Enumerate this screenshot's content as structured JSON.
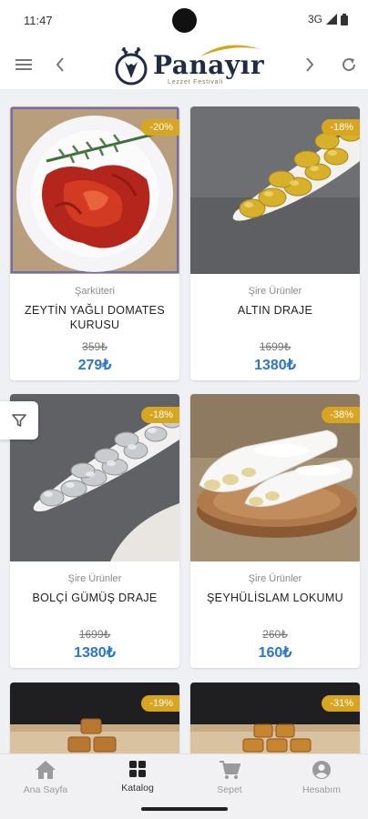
{
  "status_bar": {
    "time": "11:47",
    "network": "3G"
  },
  "header": {
    "brand": "Panayır",
    "tagline": "Lezzet Festivali"
  },
  "products": [
    {
      "category": "Şarküteri",
      "name": "ZEYTİN YAĞLI DOMATES KURUSU",
      "old_price": "359₺",
      "price": "279₺",
      "discount": "-20%",
      "image": "sun-dried-tomatoes"
    },
    {
      "category": "Şire Ürünler",
      "name": "ALTIN DRAJE",
      "old_price": "1699₺",
      "price": "1380₺",
      "discount": "-18%",
      "image": "gold-dragee"
    },
    {
      "category": "Şire Ürünler",
      "name": "BOLÇİ GÜMÜŞ DRAJE",
      "old_price": "1699₺",
      "price": "1380₺",
      "discount": "-18%",
      "image": "silver-dragee"
    },
    {
      "category": "Şire Ürünler",
      "name": "ŞEYHÜLİSLAM LOKUMU",
      "old_price": "260₺",
      "price": "160₺",
      "discount": "-38%",
      "image": "turkish-delight"
    },
    {
      "discount": "-19%",
      "image": "pastry"
    },
    {
      "discount": "-31%",
      "image": "pastry"
    }
  ],
  "nav": [
    {
      "label": "Ana Sayfa",
      "icon": "home-icon",
      "active": false
    },
    {
      "label": "Katalog",
      "icon": "grid-icon",
      "active": true
    },
    {
      "label": "Sepet",
      "icon": "cart-icon",
      "active": false
    },
    {
      "label": "Hesabım",
      "icon": "account-icon",
      "active": false
    }
  ],
  "colors": {
    "accent": "#2a77c9",
    "badge": "#d7a51f",
    "brand": "#1f2c44"
  }
}
